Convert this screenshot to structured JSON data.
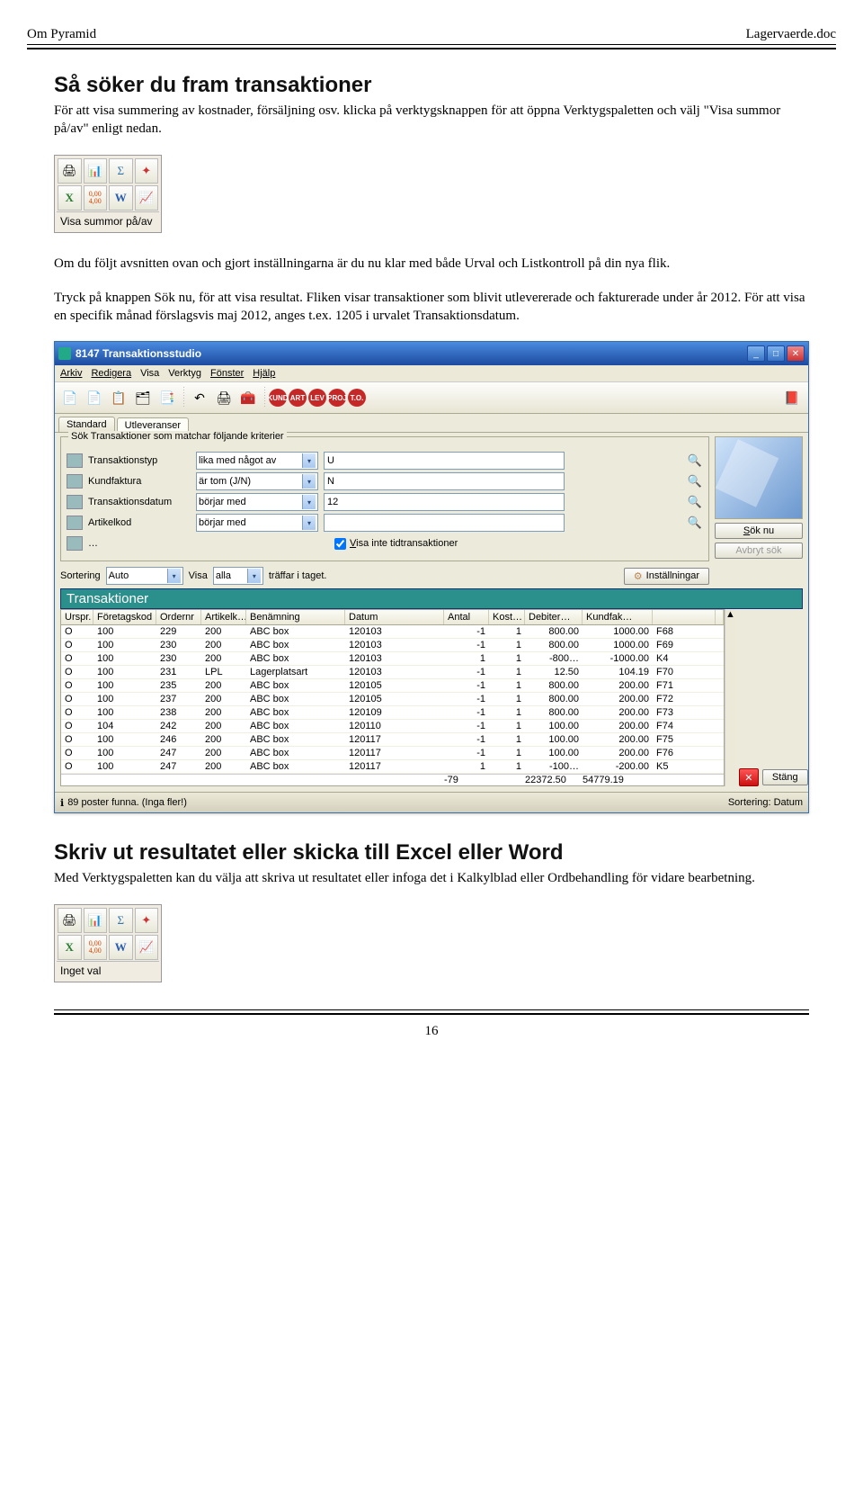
{
  "doc": {
    "header_left": "Om Pyramid",
    "header_right": "Lagervaerde.doc",
    "h1": "Så söker du fram transaktioner",
    "p1": "För att visa summering av kostnader, försäljning osv. klicka på verktygsknappen för att öppna Verktygspaletten och välj \"Visa summor på/av\" enligt nedan.",
    "palette1_label": "Visa summor på/av",
    "p2": "Om du följt avsnitten ovan och gjort inställningarna är du nu klar med både Urval och Listkontroll på din nya flik.",
    "p3": "Tryck på knappen Sök nu, för att visa resultat. Fliken visar transaktioner som blivit utlevererade och fakturerade under år 2012. För att visa en specifik månad förslagsvis maj 2012, anges t.ex. 1205 i urvalet Transaktionsdatum.",
    "h2": "Skriv ut resultatet eller skicka till Excel eller Word",
    "p4": "Med Verktygspaletten kan du välja att skriva ut resultatet eller infoga det i Kalkylblad eller Ordbehandling för vidare bearbetning.",
    "palette2_label": "Inget val",
    "page_number": "16"
  },
  "app": {
    "title": "8147 Transaktionsstudio",
    "menu": [
      "Arkiv",
      "Redigera",
      "Visa",
      "Verktyg",
      "Fönster",
      "Hjälp"
    ],
    "round_icons": [
      "KUND",
      "ART",
      "LEV",
      "PROJ",
      "T.O."
    ],
    "tabs": [
      "Standard",
      "Utleveranser"
    ],
    "search_group_title": "Sök  Transaktioner som matchar följande kriterier",
    "criteria": [
      {
        "label": "Transaktionstyp",
        "op": "lika med något av",
        "val": "U"
      },
      {
        "label": "Kundfaktura",
        "op": "är tom (J/N)",
        "val": "N"
      },
      {
        "label": "Transaktionsdatum",
        "op": "börjar med",
        "val": "12"
      },
      {
        "label": "Artikelkod",
        "op": "börjar med",
        "val": ""
      }
    ],
    "dots_label": "…",
    "hide_time_label": "Visa inte tidtransaktioner",
    "hide_time_checked": true,
    "sort_label": "Sortering",
    "sort_value": "Auto",
    "visa_label": "Visa",
    "visa_value": "alla",
    "visa_suffix": "träffar i taget.",
    "settings_btn": "Inställningar",
    "sok_nu_btn": "Sök nu",
    "avbryt_btn": "Avbryt sök",
    "area_title": "Transaktioner",
    "columns": [
      "Urspr.",
      "Företagskod",
      "Ordernr",
      "Artikelk…",
      "Benämning",
      "Datum",
      "Antal",
      "Kost…",
      "Debiter…",
      "Kundfak…"
    ],
    "rows": [
      [
        "O",
        "100",
        "229",
        "200",
        "ABC box",
        "120103",
        "-1",
        "1",
        "800.00",
        "1000.00",
        "F68"
      ],
      [
        "O",
        "100",
        "230",
        "200",
        "ABC box",
        "120103",
        "-1",
        "1",
        "800.00",
        "1000.00",
        "F69"
      ],
      [
        "O",
        "100",
        "230",
        "200",
        "ABC box",
        "120103",
        "1",
        "1",
        "-800…",
        "-1000.00",
        "K4"
      ],
      [
        "O",
        "100",
        "231",
        "LPL",
        "Lagerplatsart",
        "120103",
        "-1",
        "1",
        "12.50",
        "104.19",
        "F70"
      ],
      [
        "O",
        "100",
        "235",
        "200",
        "ABC box",
        "120105",
        "-1",
        "1",
        "800.00",
        "200.00",
        "F71"
      ],
      [
        "O",
        "100",
        "237",
        "200",
        "ABC box",
        "120105",
        "-1",
        "1",
        "800.00",
        "200.00",
        "F72"
      ],
      [
        "O",
        "100",
        "238",
        "200",
        "ABC box",
        "120109",
        "-1",
        "1",
        "800.00",
        "200.00",
        "F73"
      ],
      [
        "O",
        "104",
        "242",
        "200",
        "ABC box",
        "120110",
        "-1",
        "1",
        "100.00",
        "200.00",
        "F74"
      ],
      [
        "O",
        "100",
        "246",
        "200",
        "ABC box",
        "120117",
        "-1",
        "1",
        "100.00",
        "200.00",
        "F75"
      ],
      [
        "O",
        "100",
        "247",
        "200",
        "ABC box",
        "120117",
        "-1",
        "1",
        "100.00",
        "200.00",
        "F76"
      ],
      [
        "O",
        "100",
        "247",
        "200",
        "ABC box",
        "120117",
        "1",
        "1",
        "-100…",
        "-200.00",
        "K5"
      ]
    ],
    "sum_row": [
      "",
      "",
      "",
      "",
      "",
      "",
      "-79",
      "",
      "22372.50",
      "54779.19",
      ""
    ],
    "status_left": "89 poster funna. (Inga fler!)",
    "status_right": "Sortering: Datum",
    "close_btn": "Stäng"
  }
}
